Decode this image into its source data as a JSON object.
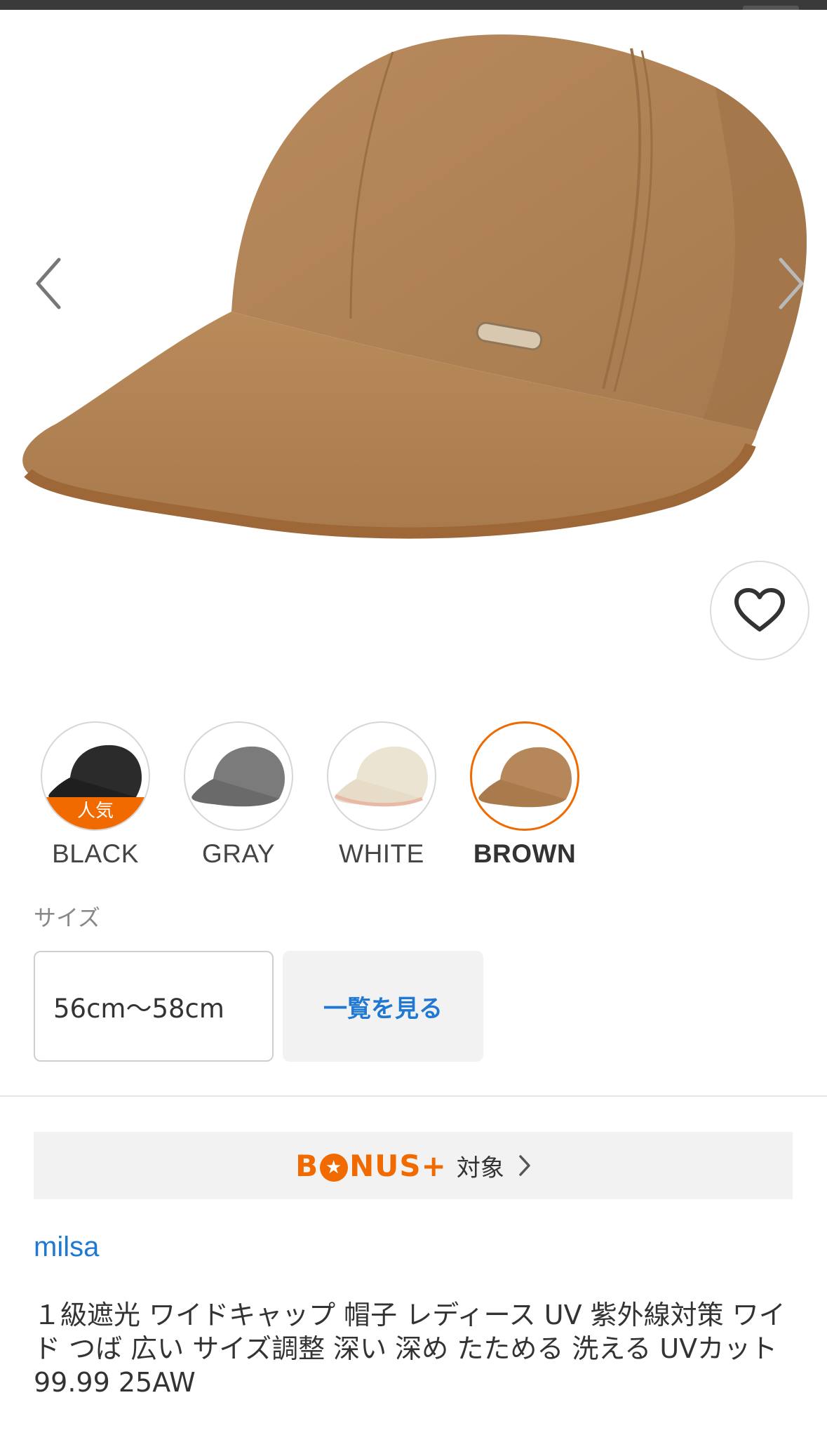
{
  "gallery": {
    "prev_icon": "chevron-left-icon",
    "next_icon": "chevron-right-icon",
    "favorite_icon": "heart-icon",
    "hat_color": "#b5875a"
  },
  "colors": {
    "accent": "#f06a00",
    "link": "#1f78d1"
  },
  "swatches": [
    {
      "label": "BLACK",
      "badge": "人気",
      "hat_color": "#2b2b2b",
      "selected": false
    },
    {
      "label": "GRAY",
      "badge": "",
      "hat_color": "#7b7b7b",
      "selected": false
    },
    {
      "label": "WHITE",
      "badge": "",
      "hat_color": "#ece4d3",
      "selected": false
    },
    {
      "label": "BROWN",
      "badge": "",
      "hat_color": "#b5875a",
      "selected": true
    }
  ],
  "size": {
    "heading": "サイズ",
    "selected_value": "56cm〜58cm",
    "list_button": "一覧を見る"
  },
  "bonus": {
    "logo_pre": "B",
    "logo_post": "NUS+",
    "target": "対象"
  },
  "brand": "milsa",
  "product_title": "１級遮光 ワイドキャップ 帽子 レディース UV 紫外線対策 ワイド つば 広い サイズ調整 深い 深め たためる 洗える UVカット 99.99 25AW"
}
